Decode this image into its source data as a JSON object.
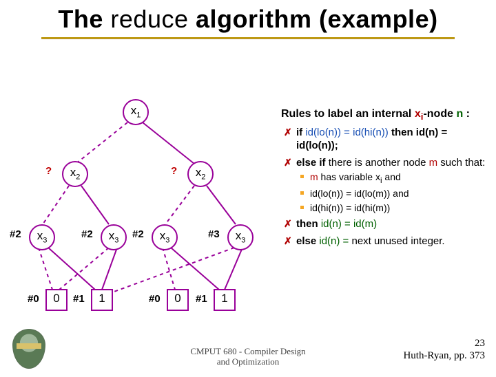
{
  "title": {
    "pre": "The ",
    "mid": "reduce",
    "post": " algorithm (example)"
  },
  "diagram": {
    "root": {
      "label": "x",
      "sub": "1",
      "tag": ""
    },
    "l2a": {
      "label": "x",
      "sub": "2",
      "tag": "?"
    },
    "l2b": {
      "label": "x",
      "sub": "2",
      "tag": "?"
    },
    "l3a": {
      "label": "x",
      "sub": "3",
      "tag": "#2"
    },
    "l3b": {
      "label": "x",
      "sub": "3",
      "tag": "#2"
    },
    "l3c": {
      "label": "x",
      "sub": "3",
      "tag": "#2"
    },
    "l3d": {
      "label": "x",
      "sub": "3",
      "tag": "#3"
    },
    "leaf0a": {
      "label": "0",
      "tag": "#0"
    },
    "leaf1a": {
      "label": "1",
      "tag": "#1"
    },
    "leaf0b": {
      "label": "0",
      "tag": "#0"
    },
    "leaf1b": {
      "label": "1",
      "tag": "#1"
    }
  },
  "rules": {
    "heading_a": "Rules to label an internal ",
    "heading_x": "x",
    "heading_xsub": "i",
    "heading_b": "-node ",
    "heading_n": "n",
    "heading_c": " :",
    "b1_if": "if ",
    "b1_cond": "id(lo(n)) = id(hi(n))",
    "b1_then": " then id(n) = id(lo(n));",
    "b2_else": "else if ",
    "b2_cond": "there is another node ",
    "b2_m": "m",
    "b2_tail": " such that:",
    "s1_a": "m",
    "s1_b": " has variable x",
    "s1_sub": "i",
    "s1_c": " and",
    "s2": "id(lo(n)) = id(lo(m)) and",
    "s3": "id(hi(n)) = id(hi(m))",
    "b3_then": "then ",
    "b3_body": "id(n) = id(m)",
    "b4_else": "else ",
    "b4_body": "id(n) = ",
    "b4_tail": "next unused integer."
  },
  "footer": {
    "line1": "CMPUT 680 - Compiler Design",
    "line2": "and Optimization"
  },
  "pagenum": "23",
  "cite": "Huth-Ryan, pp. 373",
  "chart_data": {
    "type": "table",
    "description": "Binary decision diagram (BDD) reduce-labelling example",
    "variables": [
      "x1",
      "x2",
      "x3"
    ],
    "nodes": [
      {
        "id": "root",
        "var": "x1",
        "label": null,
        "lo": "l2a",
        "hi": "l2b"
      },
      {
        "id": "l2a",
        "var": "x2",
        "label": "?",
        "lo": "l3a",
        "hi": "l3b"
      },
      {
        "id": "l2b",
        "var": "x2",
        "label": "?",
        "lo": "l3c",
        "hi": "l3d"
      },
      {
        "id": "l3a",
        "var": "x3",
        "label": "#2",
        "lo": "leaf0a",
        "hi": "leaf1a"
      },
      {
        "id": "l3b",
        "var": "x3",
        "label": "#2",
        "lo": "leaf0a",
        "hi": "leaf1a"
      },
      {
        "id": "l3c",
        "var": "x3",
        "label": "#2",
        "lo": "leaf0b",
        "hi": "leaf1b"
      },
      {
        "id": "l3d",
        "var": "x3",
        "label": "#3",
        "lo": "leaf1a",
        "hi": "leaf1b"
      },
      {
        "id": "leaf0a",
        "value": 0,
        "label": "#0"
      },
      {
        "id": "leaf1a",
        "value": 1,
        "label": "#1"
      },
      {
        "id": "leaf0b",
        "value": 0,
        "label": "#0"
      },
      {
        "id": "leaf1b",
        "value": 1,
        "label": "#1"
      }
    ],
    "edge_style": {
      "lo": "dashed",
      "hi": "solid"
    }
  }
}
